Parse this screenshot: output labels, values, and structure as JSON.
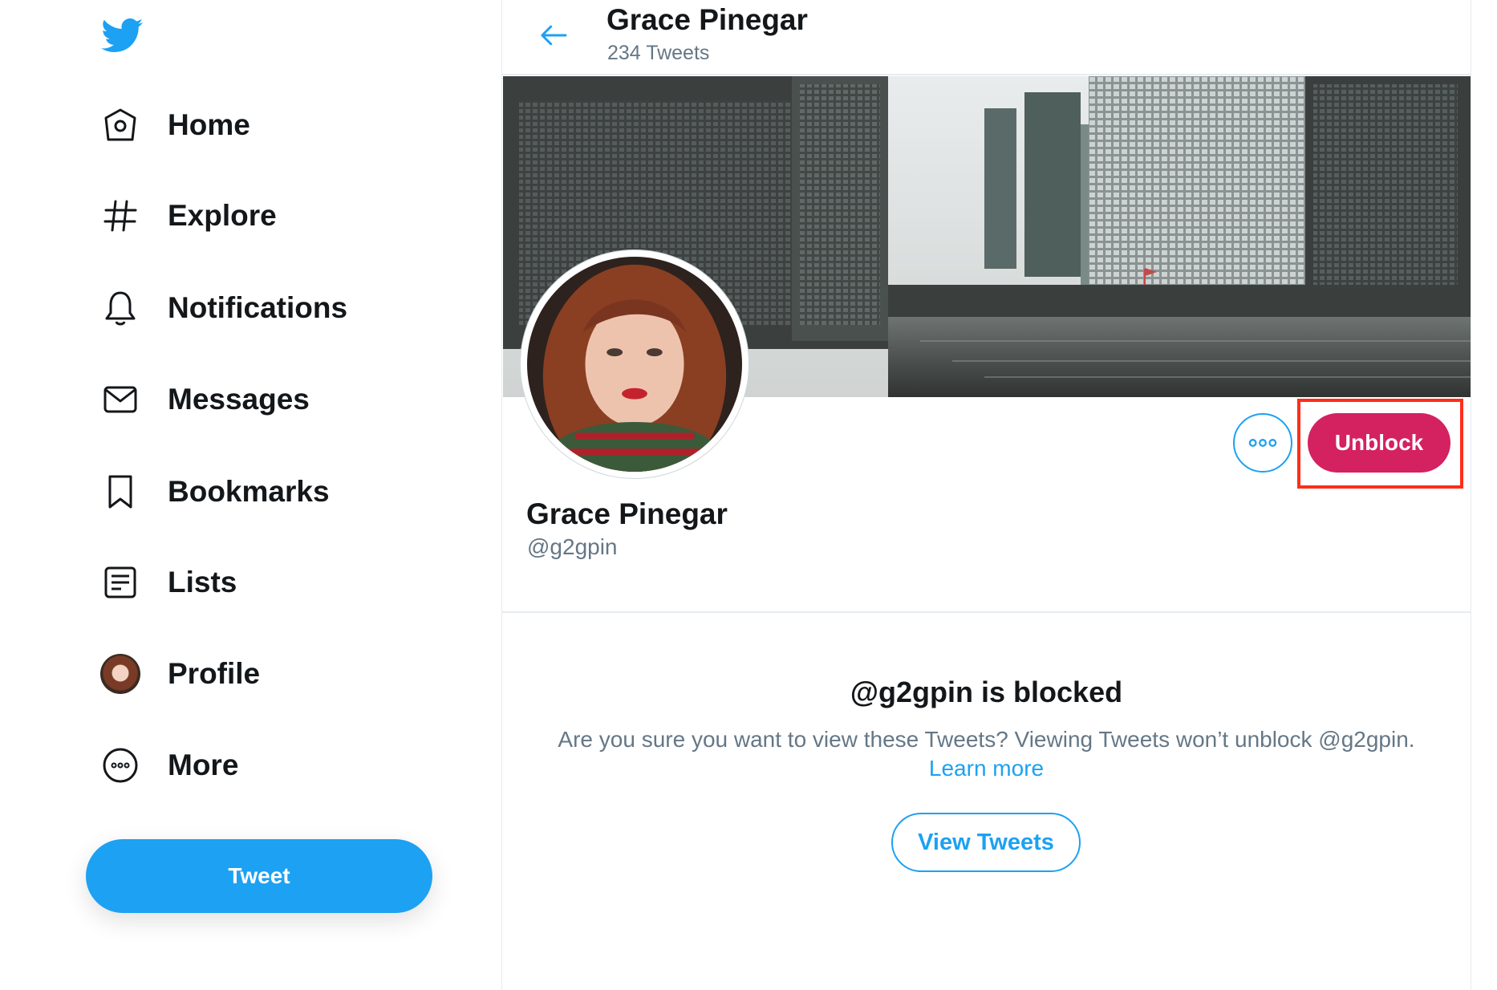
{
  "colors": {
    "accent": "#1da1f2",
    "unblock": "#d4215f",
    "highlight": "#ff2d1a",
    "text_primary": "#14171a",
    "text_secondary": "#657786"
  },
  "sidebar": {
    "logo_icon": "twitter-bird-icon",
    "items": [
      {
        "label": "Home",
        "icon": "home-icon"
      },
      {
        "label": "Explore",
        "icon": "hashtag-icon"
      },
      {
        "label": "Notifications",
        "icon": "bell-icon"
      },
      {
        "label": "Messages",
        "icon": "envelope-icon"
      },
      {
        "label": "Bookmarks",
        "icon": "bookmark-icon"
      },
      {
        "label": "Lists",
        "icon": "list-icon"
      },
      {
        "label": "Profile",
        "icon": "avatar"
      },
      {
        "label": "More",
        "icon": "more-circle-icon"
      }
    ],
    "tweet_button": "Tweet"
  },
  "header": {
    "title": "Grace Pinegar",
    "subtitle": "234 Tweets"
  },
  "profile": {
    "name": "Grace Pinegar",
    "handle": "@g2gpin",
    "unblock_label": "Unblock"
  },
  "blocked": {
    "title": "@g2gpin is blocked",
    "description": "Are you sure you want to view these Tweets? Viewing Tweets won’t unblock @g2gpin.",
    "learn_more": "Learn more",
    "view_button": "View Tweets"
  }
}
